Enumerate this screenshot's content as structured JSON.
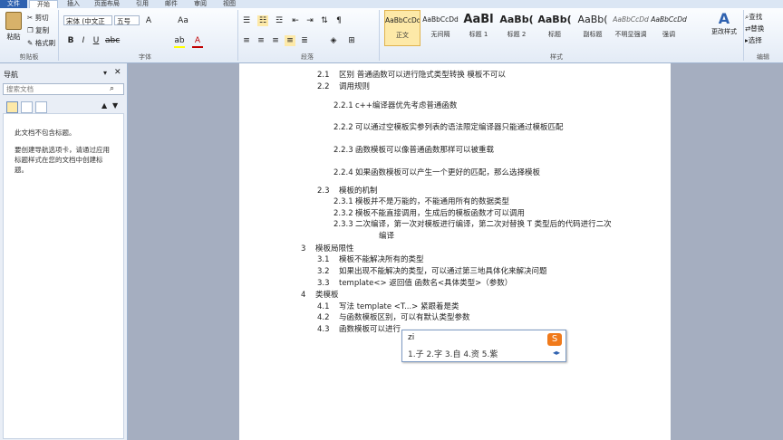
{
  "tabs": [
    "文件",
    "开始",
    "插入",
    "页面布局",
    "引用",
    "邮件",
    "审阅",
    "视图"
  ],
  "clipboard": {
    "paste": "粘贴",
    "cut": "剪切",
    "copy": "复制",
    "format_painter": "格式刷",
    "group": "剪贴板"
  },
  "font": {
    "name": "宋体 (中文正",
    "size": "五号",
    "group": "字体",
    "bold": "B",
    "italic": "I",
    "underline": "U",
    "grow": "A",
    "char_format": "Aa"
  },
  "paragraph": {
    "group": "段落"
  },
  "styles": {
    "group": "样式",
    "items": [
      {
        "preview": "AaBbCcDd",
        "name": "正文"
      },
      {
        "preview": "AaBbCcDd",
        "name": "无间隔"
      },
      {
        "preview": "AaBl",
        "name": "标题 1"
      },
      {
        "preview": "AaBb(",
        "name": "标题 2"
      },
      {
        "preview": "AaBb(",
        "name": "标题"
      },
      {
        "preview": "AaBb(",
        "name": "副标题"
      },
      {
        "preview": "AaBbCcDd",
        "name": "不明显强调"
      },
      {
        "preview": "AaBbCcDd",
        "name": "强调"
      }
    ],
    "change_styles": "更改样式"
  },
  "editing": {
    "find": "查找",
    "replace": "替换",
    "select": "选择",
    "group": "编辑"
  },
  "nav": {
    "title": "导航",
    "search_placeholder": "搜索文档",
    "msg1": "此文档不包含标题。",
    "msg2": "要创建导航选项卡，请通过应用标题样式在您的文档中创建标题。"
  },
  "doc": {
    "lines": [
      {
        "num": "2.1",
        "text": "区别 普通函数可以进行隐式类型转换  模板不可以"
      },
      {
        "num": "2.2",
        "text": "调用规则"
      },
      {
        "num": "2.2.1",
        "text": "c++编译器优先考虑普通函数"
      },
      {
        "num": "2.2.2",
        "text": "可以通过空模板实参列表的语法限定编译器只能通过模板匹配"
      },
      {
        "num": "2.2.3",
        "text": "函数模板可以像普通函数那样可以被重载"
      },
      {
        "num": "2.2.4",
        "text": "如果函数模板可以产生一个更好的匹配，那么选择模板"
      },
      {
        "num": "2.3",
        "text": "模板的机制"
      },
      {
        "num": "2.3.1",
        "text": "模板并不是万能的，不能通用所有的数据类型"
      },
      {
        "num": "2.3.2",
        "text": "模板不能直接调用，生成后的模板函数才可以调用"
      },
      {
        "num": "2.3.3",
        "text": "二次编译，第一次对模板进行编译，第二次对替换 T 类型后的代码进行二次"
      },
      {
        "num": "",
        "text": "编译"
      },
      {
        "num": "3",
        "text": "模板局限性"
      },
      {
        "num": "3.1",
        "text": "模板不能解决所有的类型"
      },
      {
        "num": "3.2",
        "text": "如果出现不能解决的类型，可以通过第三地具体化来解决问题"
      },
      {
        "num": "3.3",
        "text": "template<> 返回值 函数名<具体类型>（参数）"
      },
      {
        "num": "4",
        "text": "类模板"
      },
      {
        "num": "4.1",
        "text": "写法 template <T...> 紧跟着是类"
      },
      {
        "num": "4.2",
        "text": "与函数模板区别，可以有默认类型参数"
      },
      {
        "num": "4.3",
        "text": "函数模板可以进行"
      }
    ]
  },
  "ime": {
    "input": "zi",
    "candidates": "1.子  2.字  3.自  4.资  5.紫",
    "logo": "S"
  }
}
